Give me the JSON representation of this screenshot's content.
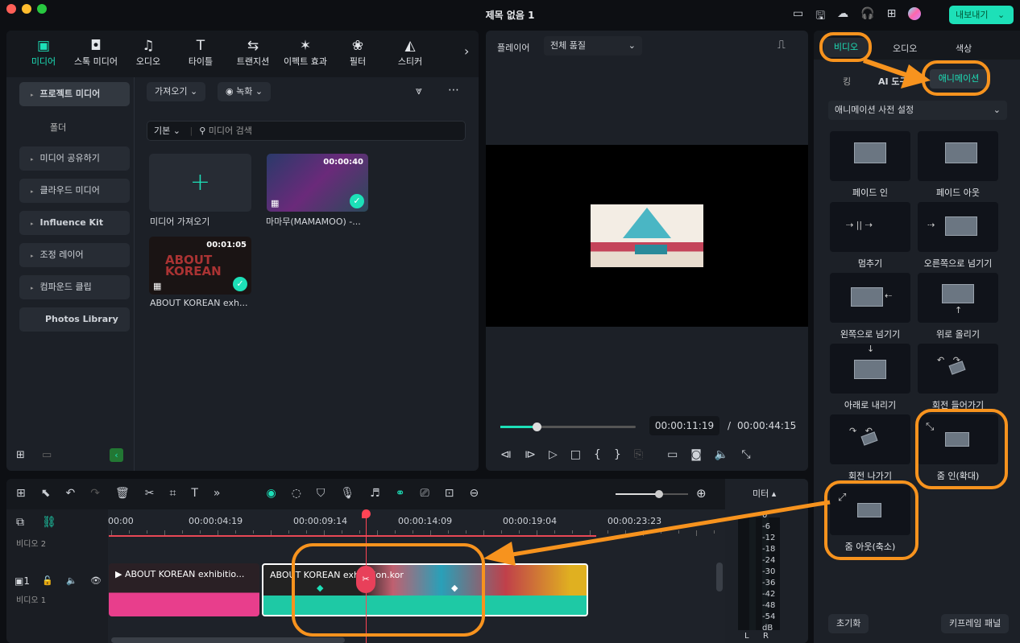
{
  "window": {
    "title": "제목 없음 1",
    "export_label": "내보내기",
    "accent": "#1de0b8"
  },
  "top_icons": [
    "layout-icon",
    "save-icon",
    "cloud-icon",
    "headset-icon",
    "grid-icon",
    "avatar"
  ],
  "media_tabs": [
    {
      "label": "미디어",
      "icon": "▣"
    },
    {
      "label": "스톡 미디어",
      "icon": "◘"
    },
    {
      "label": "오디오",
      "icon": "♫"
    },
    {
      "label": "타이틀",
      "icon": "T"
    },
    {
      "label": "트랜지션",
      "icon": "⇆"
    },
    {
      "label": "이펙트 효과",
      "icon": "✶"
    },
    {
      "label": "필터",
      "icon": "❀"
    },
    {
      "label": "스티커",
      "icon": "◭"
    }
  ],
  "sidebar": {
    "items": [
      "프로젝트 미디어",
      "폴더",
      "미디어 공유하기",
      "클라우드 미디어",
      "Influence Kit",
      "조정 레이어",
      "컴파운드 클립",
      "Photos Library"
    ]
  },
  "media": {
    "import_label": "가져오기",
    "record_label": "녹화",
    "view_label": "기본",
    "search_placeholder": "미디어 검색",
    "items": [
      {
        "name": "미디어 가져오기"
      },
      {
        "name": "마마무(MAMAMOO) -...",
        "duration": "00:00:40"
      },
      {
        "name": "ABOUT KOREAN exh...",
        "duration": "00:01:05"
      }
    ]
  },
  "player": {
    "label": "플레이어",
    "quality": "전체 품질",
    "current_time": "00:00:11:19",
    "separator": "/",
    "total_time": "00:00:44:15",
    "progress": 0.27
  },
  "right_panel": {
    "tabs": [
      "비디오",
      "오디오",
      "색상"
    ],
    "subtabs": [
      "킹",
      "AI 도구",
      "애니메이션"
    ],
    "preset_select": "애니메이션 사전 설정",
    "animations": [
      "페이드 인",
      "페이드 아웃",
      "멈추기",
      "오른쪽으로 넘기기",
      "왼쪽으로 넘기기",
      "위로 올리기",
      "아래로 내리기",
      "회전 들어가기",
      "회전 나가기",
      "줌 인(확대)",
      "줌 아웃(축소)"
    ],
    "reset_label": "초기화",
    "keyframe_label": "키프레임 패널"
  },
  "timeline": {
    "ruler": [
      "00:00",
      "00:00:04:19",
      "00:00:09:14",
      "00:00:14:09",
      "00:00:19:04",
      "00:00:23:23"
    ],
    "track2_label": "비디오 2",
    "track1_label": "비디오 1",
    "track1_num": "1",
    "clips": [
      {
        "title": "ABOUT KOREAN exhibitio...",
        "color": "#e83e8c"
      },
      {
        "title": "ABOUT KOREAN exhibition.kor",
        "color": "#1ec9a5"
      }
    ],
    "zoom_level": 0.6
  },
  "meter": {
    "label": "미터",
    "scale": [
      "0",
      "-6",
      "-12",
      "-18",
      "-24",
      "-30",
      "-36",
      "-42",
      "-48",
      "-54",
      "dB"
    ],
    "channels": [
      "L",
      "R"
    ]
  },
  "annotation_color": "#f7931e"
}
